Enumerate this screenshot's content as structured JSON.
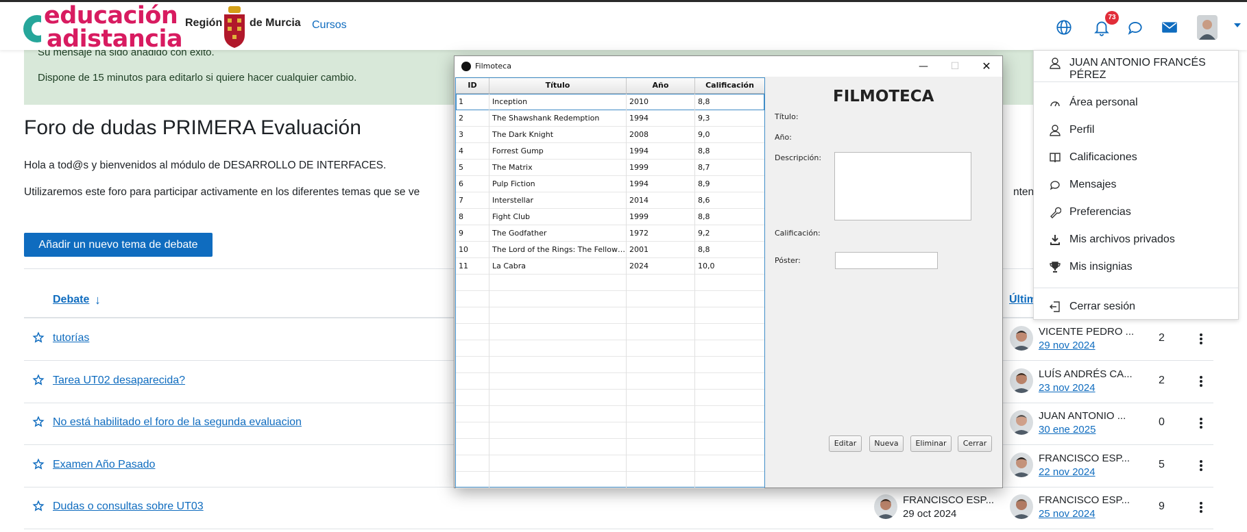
{
  "brand": {
    "line1": "educación",
    "line2": "adistancia",
    "region_left": "Región",
    "region_right": "de Murcia"
  },
  "nav": {
    "courses_label": "Cursos",
    "notification_count": "73",
    "icons": [
      "globe-icon",
      "bell-icon",
      "chat-icon",
      "envelope-icon"
    ]
  },
  "alert": {
    "line1": "Su mensaje ha sido añadido con éxito.",
    "line2": "Dispone de 15 minutos para editarlo si quiere hacer cualquier cambio."
  },
  "forum": {
    "title": "Foro de dudas PRIMERA Evaluación",
    "intro1": "Hola a tod@s y bienvenidos al módulo de DESARROLLO DE INTERFACES.",
    "intro2_left": "Utilizaremos este foro para participar activamente en los diferentes temas que se ve",
    "intro2_right": "ntenid",
    "add_topic_label": "Añadir un nuevo tema de debate",
    "col_debate": "Debate",
    "col_last": "Últim"
  },
  "discussions": [
    {
      "title": "tutorías",
      "started_by": "",
      "started_date": "",
      "last_by": "VICENTE PEDRO ...",
      "last_date": "29 nov 2024",
      "replies": "2"
    },
    {
      "title": "Tarea UT02 desaparecida?",
      "started_by": "",
      "started_date": "",
      "last_by": "LUÍS ANDRÉS CA...",
      "last_date": "23 nov 2024",
      "replies": "2"
    },
    {
      "title": "No está habilitado el foro de la segunda evaluacion",
      "started_by": "",
      "started_date": "",
      "last_by": "JUAN ANTONIO ...",
      "last_date": "30 ene 2025",
      "replies": "0"
    },
    {
      "title": "Examen Año Pasado",
      "started_by": "",
      "started_date": "",
      "last_by": "FRANCISCO ESP...",
      "last_date": "22 nov 2024",
      "replies": "5"
    },
    {
      "title": "Dudas o consultas sobre UT03",
      "started_by": "FRANCISCO ESP...",
      "started_date": "29 oct 2024",
      "last_by": "FRANCISCO ESP...",
      "last_date": "25 nov 2024",
      "replies": "9"
    }
  ],
  "user_menu": {
    "user_name": "JUAN ANTONIO FRANCÉS PÉREZ",
    "items": [
      {
        "label": "Área personal",
        "icon": "gauge-icon"
      },
      {
        "label": "Perfil",
        "icon": "user-icon"
      },
      {
        "label": "Calificaciones",
        "icon": "grades-book-icon"
      },
      {
        "label": "Mensajes",
        "icon": "chat-icon"
      },
      {
        "label": "Preferencias",
        "icon": "wrench-icon"
      },
      {
        "label": "Mis archivos privados",
        "icon": "download-icon"
      },
      {
        "label": "Mis insignias",
        "icon": "trophy-icon"
      }
    ],
    "logout_label": "Cerrar sesión"
  },
  "app_window": {
    "title": "Filmoteca",
    "columns": [
      "ID",
      "Título",
      "Año",
      "Calificación"
    ],
    "rows": [
      [
        "1",
        "Inception",
        "2010",
        "8,8"
      ],
      [
        "2",
        "The Shawshank Redemption",
        "1994",
        "9,3"
      ],
      [
        "3",
        "The Dark Knight",
        "2008",
        "9,0"
      ],
      [
        "4",
        "Forrest Gump",
        "1994",
        "8,8"
      ],
      [
        "5",
        "The Matrix",
        "1999",
        "8,7"
      ],
      [
        "6",
        "Pulp Fiction",
        "1994",
        "8,9"
      ],
      [
        "7",
        "Interstellar",
        "2014",
        "8,6"
      ],
      [
        "8",
        "Fight Club",
        "1999",
        "8,8"
      ],
      [
        "9",
        "The Godfather",
        "1972",
        "9,2"
      ],
      [
        "10",
        "The Lord of the Rings: The Fellows...",
        "2001",
        "8,8"
      ],
      [
        "11",
        "La Cabra",
        "2024",
        "10,0"
      ]
    ],
    "selected_row": 0,
    "heading": "FILMOTECA",
    "labels": {
      "title": "Título:",
      "year": "Año:",
      "description": "Descripción:",
      "rating": "Calificación:",
      "poster": "Póster:"
    },
    "buttons": {
      "edit": "Editar",
      "new": "Nueva",
      "delete": "Eliminar",
      "close": "Cerrar"
    }
  }
}
